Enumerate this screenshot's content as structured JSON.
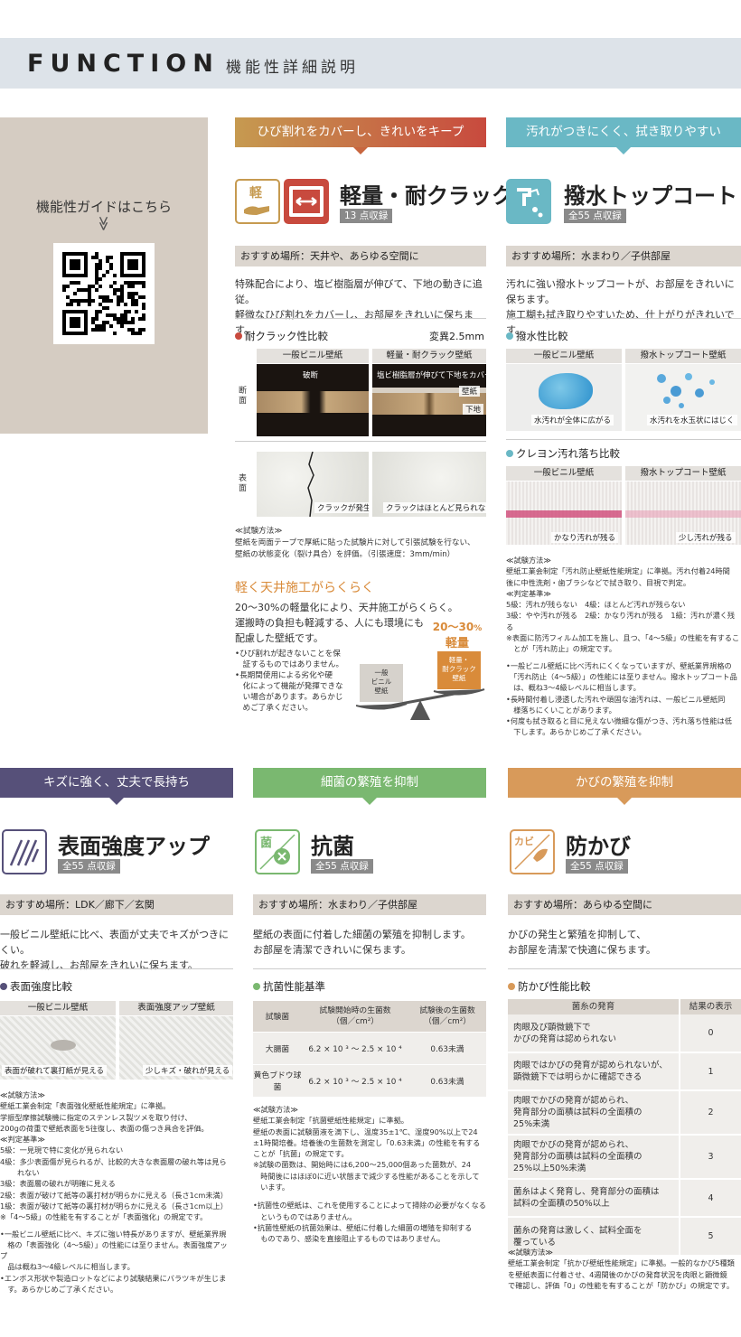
{
  "header": {
    "title": "FUNCTION",
    "subtitle": "機能性詳細説明"
  },
  "guide": {
    "text": "機能性ガイドはこちら",
    "chevron": "≫"
  },
  "sec1": {
    "banner": "ひび割れをカバーし、きれいをキープ",
    "icon_text": "軽",
    "title": "軽量・耐クラック",
    "badge": "13 点収録",
    "place": "おすすめ場所：天井や、あらゆる空間に",
    "desc": [
      "特殊配合により、塩ビ樹脂層が伸びて、下地の動きに追従。",
      "軽微なひび割れをカバーし、お部屋をきれいに保ちます。"
    ],
    "compare_title": "耐クラック性比較",
    "compare_note": "変異2.5mm",
    "col1": "一般ビニル壁紙",
    "col2": "軽量・耐クラック壁紙",
    "row1": "断面",
    "row2": "表面",
    "cap_break": "破断",
    "cap_stretch": "塩ビ樹脂層が伸びて下地をカバー",
    "cap_wall": "壁紙",
    "cap_base": "下地",
    "cap_crack": "クラックが発生",
    "cap_nocrack": "クラックはほとんど見られない",
    "test": [
      "≪試験方法≫",
      "壁紙を両面テープで厚紙に貼った試験片に対して引張試験を行ない、",
      "壁紙の状態変化（裂け具合）を評価。（引張速度：3mm/min）"
    ],
    "sub_title": "軽く天井施工がらくらく",
    "sub_desc": [
      "20～30%の軽量化により、天井施工がらくらく。",
      "運搬時の負担も軽減する、人にも環境にも",
      "配慮した壁紙です。"
    ],
    "bullets": [
      "•ひび割れが起きないことを保",
      "　証するものではありません。",
      "•長期間使用による劣化や硬",
      "　化によって機能が発揮できな",
      "　い場合があります。あらかじ",
      "　めご了承ください。"
    ],
    "scale_pct": "20～30",
    "scale_pct_unit": "%",
    "scale_light": "軽量",
    "scale_left": [
      "一般",
      "ビニル",
      "壁紙"
    ],
    "scale_right": [
      "軽量・",
      "耐クラック",
      "壁紙"
    ]
  },
  "sec2": {
    "banner": "汚れがつきにくく、拭き取りやすい",
    "title": "撥水トップコート",
    "badge": "全55 点収録",
    "place": "おすすめ場所：水まわり／子供部屋",
    "desc": [
      "汚れに強い撥水トップコートが、お部屋をきれいに保ちます。",
      "施工糊も拭き取りやすいため、仕上がりがきれいです。"
    ],
    "compare1_title": "撥水性比較",
    "col1": "一般ビニル壁紙",
    "col2": "撥水トップコート壁紙",
    "cap1a": "水汚れが全体に広がる",
    "cap1b": "水汚れを水玉状にはじく",
    "compare2_title": "クレヨン汚れ落ち比較",
    "cap2a": "かなり汚れが残る",
    "cap2b": "少し汚れが残る",
    "test": [
      "≪試験方法≫",
      "壁紙工業会制定「汚れ防止壁紙性能規定」に準拠。汚れ付着24時間",
      "後に中性洗剤・歯ブラシなどで拭き取り、目視で判定。",
      "≪判定基準≫",
      "5級：汚れが残らない　4級：ほとんど汚れが残らない",
      "3級：やや汚れが残る　2級：かなり汚れが残る　1級：汚れが濃く残る",
      "※表面に防汚フィルム加工を施し、且つ、「4～5級」の性能を有するこ",
      "　とが「汚れ防止」の規定です。",
      "",
      "•一般ビニル壁紙に比べ汚れにくくなっていますが、壁紙業界規格の",
      "　「汚れ防止（4～5級）」の性能には至りません。撥水トップコート品",
      "　は、概ね3～4級レベルに相当します。",
      "•長時間付着し浸透した汚れや頑固な油汚れは、一般ビニル壁紙同",
      "　様落ちにくいことがあります。",
      "•何度も拭き取ると目に見えない微細な傷がつき、汚れ落ち性能は低",
      "　下します。あらかじめご了承ください。"
    ]
  },
  "sec3": {
    "banner": "キズに強く、丈夫で長持ち",
    "title": "表面強度アップ",
    "badge": "全55 点収録",
    "place": "おすすめ場所：LDK／廊下／玄関",
    "desc": [
      "一般ビニル壁紙に比べ、表面が丈夫でキズがつきにくい。",
      "破れを軽減し、お部屋をきれいに保ちます。"
    ],
    "compare_title": "表面強度比較",
    "col1": "一般ビニル壁紙",
    "col2": "表面強度アップ壁紙",
    "cap_a": "表面が破れて裏打紙が見える",
    "cap_b": "少しキズ・破れが見える",
    "test": [
      "≪試験方法≫",
      "壁紙工業会制定「表面強化壁紙性能規定」に準拠。",
      "学振型摩擦試験機に指定のステンレス製ツメを取り付け、",
      "200gの荷重で壁紙表面を5往復し、表面の傷つき具合を評価。",
      "≪判定基準≫",
      "5級：一見現で特に変化が見られない",
      "4級：多少表面傷が見られるが、比較的大きな表面層の破れ等は見ら",
      "　　 れない",
      "3級：表面層の破れが明確に見える",
      "2級：表面が破けて紙等の裏打材が明らかに見える（長さ1cm未満）",
      "1級：表面が破けて紙等の裏打材が明らかに見える（長さ1cm以上）",
      "※「4～5級」の性能を有することが「表面強化」の規定です。",
      "",
      "•一般ビニル壁紙に比べ、キズに強い特長がありますが、壁紙業界規",
      "　格の「表面強化（4～5級）」の性能には至りません。表面強度アップ",
      "　品は概ね3～4級レベルに相当します。",
      "•エンボス形状や製造ロットなどにより試験結果にバラツキが生じま",
      "　す。あらかじめご了承ください。"
    ]
  },
  "sec4": {
    "banner": "細菌の繁殖を抑制",
    "icon_text": "菌",
    "title": "抗菌",
    "badge": "全55 点収録",
    "place": "おすすめ場所：水まわり／子供部屋",
    "desc": [
      "壁紙の表面に付着した細菌の繁殖を抑制します。",
      "お部屋を清潔できれいに保ちます。"
    ],
    "table_title": "抗菌性能基準",
    "th": [
      "試験菌",
      "試験開始時の生菌数",
      "（個／cm²）",
      "試験後の生菌数",
      "（個／cm²）"
    ],
    "rows": [
      [
        "大腸菌",
        "6.2 × 10 ³ ～ 2.5 × 10 ⁴",
        "0.63未満"
      ],
      [
        "黄色ブドウ球菌",
        "6.2 × 10 ³ ～ 2.5 × 10 ⁴",
        "0.63未満"
      ]
    ],
    "test": [
      "≪試験方法≫",
      "壁紙工業会制定「抗菌壁紙性能規定」に準拠。",
      "壁紙の表面に試験菌液を滴下し、温度35±1℃、湿度90%以上で24",
      "±1時間培養。培養後の生菌数を測定し「0.63未満」の性能を有する",
      "ことが「抗菌」の規定です。",
      "※試験の菌数は、開始時には6,200～25,000個あった菌数が、24",
      "　時間後にはほぼ0に近い状態まで減少する性能があることを示して",
      "　います。",
      "",
      "•抗菌性の壁紙は、これを使用することによって掃除の必要がなくなる",
      "　というものではありません。",
      "•抗菌性壁紙の抗菌効果は、壁紙に付着した細菌の増殖を抑制する",
      "　ものであり、感染を直接阻止するものではありません。"
    ]
  },
  "sec5": {
    "banner": "かびの繁殖を抑制",
    "icon_text": "カビ",
    "title": "防かび",
    "badge": "全55 点収録",
    "place": "おすすめ場所：あらゆる空間に",
    "desc": [
      "かびの発生と繁殖を抑制して、",
      "お部屋を清潔で快適に保ちます。"
    ],
    "table_title": "防かび性能比較",
    "th": [
      "菌糸の発育",
      "結果の表示"
    ],
    "rows": [
      [
        [
          "肉眼及び顕微鏡下で",
          "かびの発育は認められない"
        ],
        "0"
      ],
      [
        [
          "肉眼ではかびの発育が認められないが、",
          "顕微鏡下では明らかに確認できる"
        ],
        "1"
      ],
      [
        [
          "肉眼でかびの発育が認められ、",
          "発育部分の面積は試料の全面積の",
          "25%未満"
        ],
        "2"
      ],
      [
        [
          "肉眼でかびの発育が認められ、",
          "発育部分の面積は試料の全面積の",
          "25%以上50%未満"
        ],
        "3"
      ],
      [
        [
          "菌糸はよく発育し、発育部分の面積は",
          "試料の全面積の50%以上"
        ],
        "4"
      ],
      [
        [
          "菌糸の発育は激しく、試料全面を",
          "覆っている"
        ],
        "5"
      ]
    ],
    "test": [
      "≪試験方法≫",
      "壁紙工業会制定「抗かび壁紙性能規定」に準拠。一般的なかび5種類",
      "を壁紙表面に付着させ、4週間後のかびの発育状況を肉眼と顕微鏡",
      "で確認し、評価「0」の性能を有することが「防かび」の規定です。"
    ]
  },
  "colors": {
    "red": "#c84a3e",
    "teal": "#6ab8c5",
    "purple": "#565079",
    "green": "#7ab870",
    "orange": "#d89a5a",
    "accent_text": "#d98b3a"
  }
}
